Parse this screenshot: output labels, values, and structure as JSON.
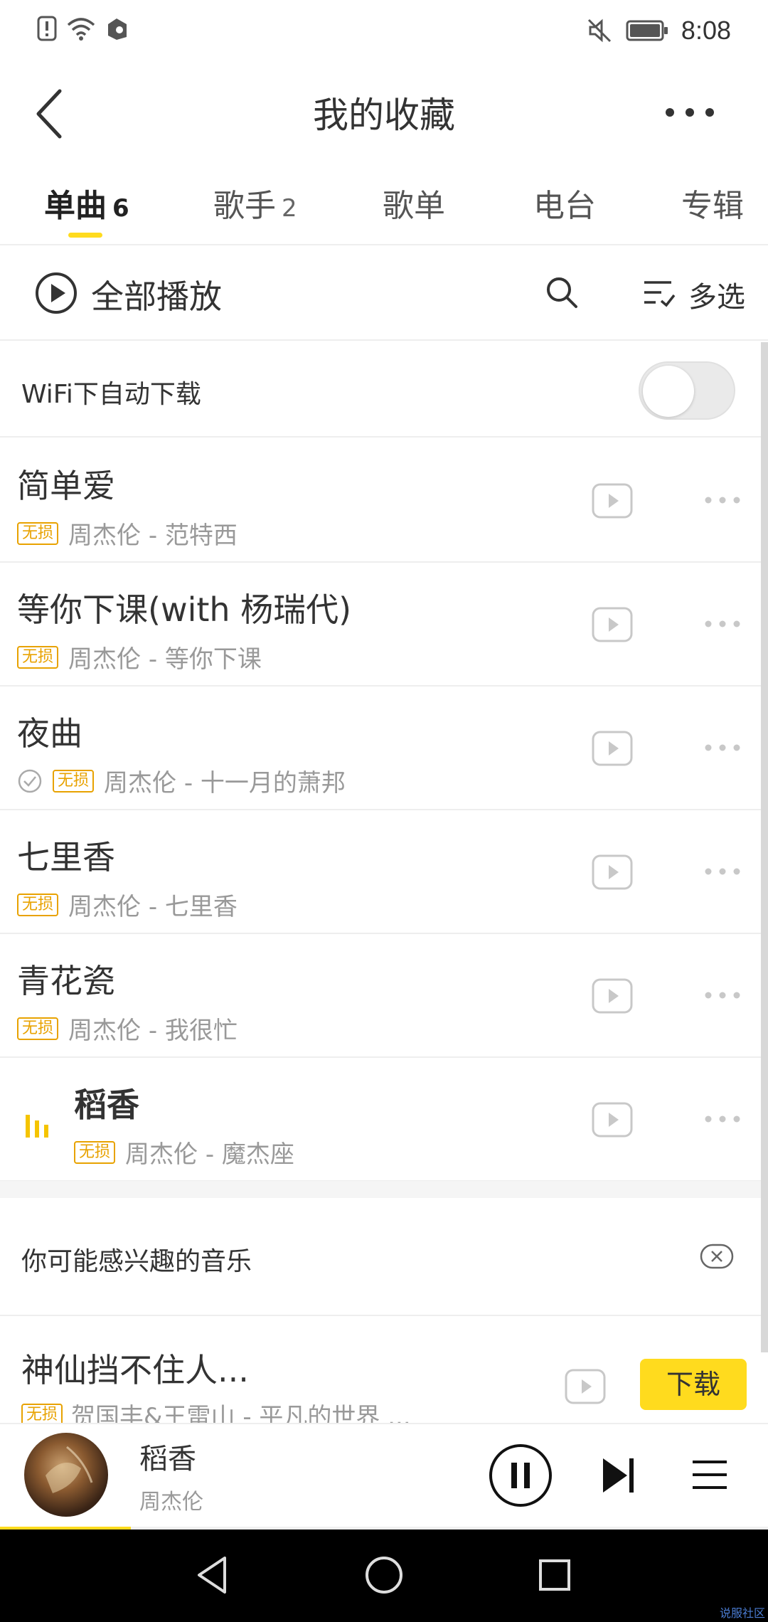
{
  "status_bar": {
    "time": "8:08",
    "left_icons": [
      "alert-icon",
      "wifi-icon",
      "app-notification-icon"
    ],
    "right_icons": [
      "mute-icon",
      "battery-icon"
    ]
  },
  "header": {
    "title": "我的收藏",
    "back_icon": "back-arrow-icon",
    "more_icon": "more-dots-icon"
  },
  "tabs": [
    {
      "label": "单曲",
      "count": "6",
      "active": true
    },
    {
      "label": "歌手",
      "count": "2",
      "active": false
    },
    {
      "label": "歌单",
      "count": "",
      "active": false
    },
    {
      "label": "电台",
      "count": "",
      "active": false
    },
    {
      "label": "专辑",
      "count": "",
      "active": false
    }
  ],
  "action_bar": {
    "play_all": "全部播放",
    "multi_select": "多选"
  },
  "wifi_download": {
    "label": "WiFi下自动下载",
    "enabled": false
  },
  "songs": [
    {
      "title": "简单爱",
      "badge": "无损",
      "artist": "周杰伦 - 范特西",
      "downloaded": false,
      "playing": false
    },
    {
      "title": "等你下课(with 杨瑞代)",
      "badge": "无损",
      "artist": "周杰伦 - 等你下课",
      "downloaded": false,
      "playing": false
    },
    {
      "title": "夜曲",
      "badge": "无损",
      "artist": "周杰伦 - 十一月的萧邦",
      "downloaded": true,
      "playing": false
    },
    {
      "title": "七里香",
      "badge": "无损",
      "artist": "周杰伦 - 七里香",
      "downloaded": false,
      "playing": false
    },
    {
      "title": "青花瓷",
      "badge": "无损",
      "artist": "周杰伦 - 我很忙",
      "downloaded": false,
      "playing": false
    },
    {
      "title": "稻香",
      "badge": "无损",
      "artist": "周杰伦 - 魔杰座",
      "downloaded": false,
      "playing": true
    }
  ],
  "recommend": {
    "label": "你可能感兴趣的音乐",
    "close_icon": "close-icon",
    "song": {
      "title": "神仙挡不住人...",
      "badge": "无损",
      "artist": "贺国丰&王雷山 - 平凡的世界 ...",
      "download_label": "下载"
    }
  },
  "mini_player": {
    "title": "稻香",
    "artist": "周杰伦",
    "progress": 0.17
  },
  "nav_icons": [
    "nav-back-icon",
    "nav-home-icon",
    "nav-recents-icon"
  ],
  "watermark": "说服社区",
  "colors": {
    "accent": "#ffdb1e",
    "accent_dark": "#f5c400",
    "badge": "#e8a200",
    "text_primary": "#333333",
    "text_secondary": "#999999"
  }
}
